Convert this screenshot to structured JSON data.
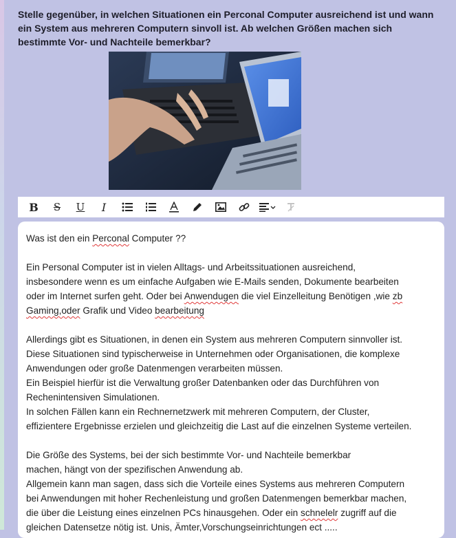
{
  "question": "Stelle gegenüber, in welchen Situationen ein Perconal Computer ausreichend ist und wann ein System aus mehreren Computern sinvoll ist. Ab welchen Größen machen sich bestimmte Vor- und Nachteile bemerkbar?",
  "toolbar": {
    "buttons": [
      "bold-icon",
      "strikethrough-icon",
      "underline-icon",
      "italic-icon",
      "bullet-list-icon",
      "numbered-list-icon",
      "text-color-icon",
      "highlight-pen-icon",
      "image-icon",
      "link-icon",
      "align-left-icon",
      "clear-format-icon"
    ]
  },
  "editor": {
    "l1a": "Was ist den ein ",
    "l1b": "Perconal",
    "l1c": " Computer ??",
    "l2": "Ein Personal Computer  ist in vielen Alltags- und Arbeitssituationen ausreichend,",
    "l3": "insbesondere wenn es um einfache Aufgaben wie E-Mails senden, Dokumente bearbeiten",
    "l4a": "oder im Internet surfen geht. Oder bei ",
    "l4b": "Anwendugen",
    "l4c": " die viel Einzelleitung Benötigen ,wie ",
    "l4d": "zb",
    "l5a": "Gaming,oder",
    "l5b": " Grafik und Video ",
    "l5c": "bearbeitung",
    "l6": "Allerdings gibt es Situationen, in denen ein System aus mehreren Computern sinnvoller ist.",
    "l7": "Diese Situationen sind typischerweise in Unternehmen oder Organisationen, die komplexe",
    "l8": "Anwendungen oder große Datenmengen verarbeiten müssen.",
    "l9": "Ein Beispiel hierfür ist die Verwaltung großer Datenbanken oder das Durchführen von",
    "l10": "Rechenintensiven Simulationen.",
    "l11": "In solchen Fällen kann ein Rechnernetzwerk mit mehreren Computern, der Cluster,",
    "l12": "effizientere Ergebnisse erzielen und gleichzeitig die Last auf die einzelnen Systeme verteilen.",
    "l13": "Die Größe des Systems, bei der sich bestimmte Vor- und Nachteile bemerkbar",
    "l14": "machen, hängt von der spezifischen Anwendung ab.",
    "l15": "Allgemein kann man sagen, dass sich die Vorteile eines Systems aus mehreren Computern",
    "l16": "bei Anwendungen mit hoher Rechenleistung und großen Datenmengen bemerkbar machen,",
    "l17a": "die über die Leistung eines einzelnen PCs hinausgehen. Oder ein ",
    "l17b": "schnelelr",
    "l17c": " zugriff auf die",
    "l18": "gleichen Datensetze nötig ist. Unis, Ämter,Vorschungseinrichtungen ect ....."
  }
}
